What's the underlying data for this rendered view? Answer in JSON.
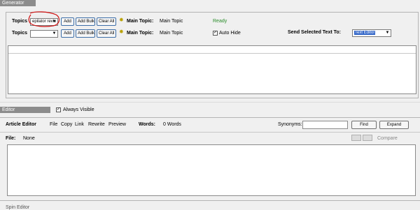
{
  "generator": {
    "title": "Generator",
    "row1": {
      "topics_label": "Topics",
      "topics_value": "epilator revie",
      "add_label": "Add",
      "add_bulk_label": "Add Bulk",
      "clear_all_label": "Clear All",
      "main_topic_label": "Main Topic:",
      "main_topic_value": "Main Topic",
      "status": "Ready"
    },
    "row2": {
      "topics_label": "Topics",
      "topics_value": "",
      "add_label": "Add",
      "add_bulk_label": "Add Bulk",
      "clear_all_label": "Clear All",
      "main_topic_label": "Main Topic:",
      "main_topic_value": "Main Topic",
      "auto_hide_label": "Auto Hide",
      "auto_hide_checked": true,
      "send_label": "Send Selected Text To:",
      "send_value": "Text Editor"
    }
  },
  "editor": {
    "title": "Editor",
    "always_visible_label": "Always Visible",
    "always_visible_checked": true,
    "article_editor_label": "Article Editor",
    "menu": [
      "File",
      "Copy",
      "Link",
      "Rewrite",
      "Preview"
    ],
    "words_label": "Words:",
    "words_value": "0 Words",
    "synonyms_label": "Synonyms:",
    "find_label": "Find",
    "expand_label": "Expand",
    "file_label": "File:",
    "file_value": "None",
    "compare_label": "Compare"
  },
  "spin_editor": {
    "title": "Spin Editor"
  },
  "colors": {
    "titlebar": "#8c8c8c",
    "ready": "#2a8c2a",
    "selection": "#3266c8",
    "annotation": "#d01010"
  },
  "icons": {
    "main_topic": "lightbulb-icon",
    "dropdown": "chevron-down-icon"
  }
}
